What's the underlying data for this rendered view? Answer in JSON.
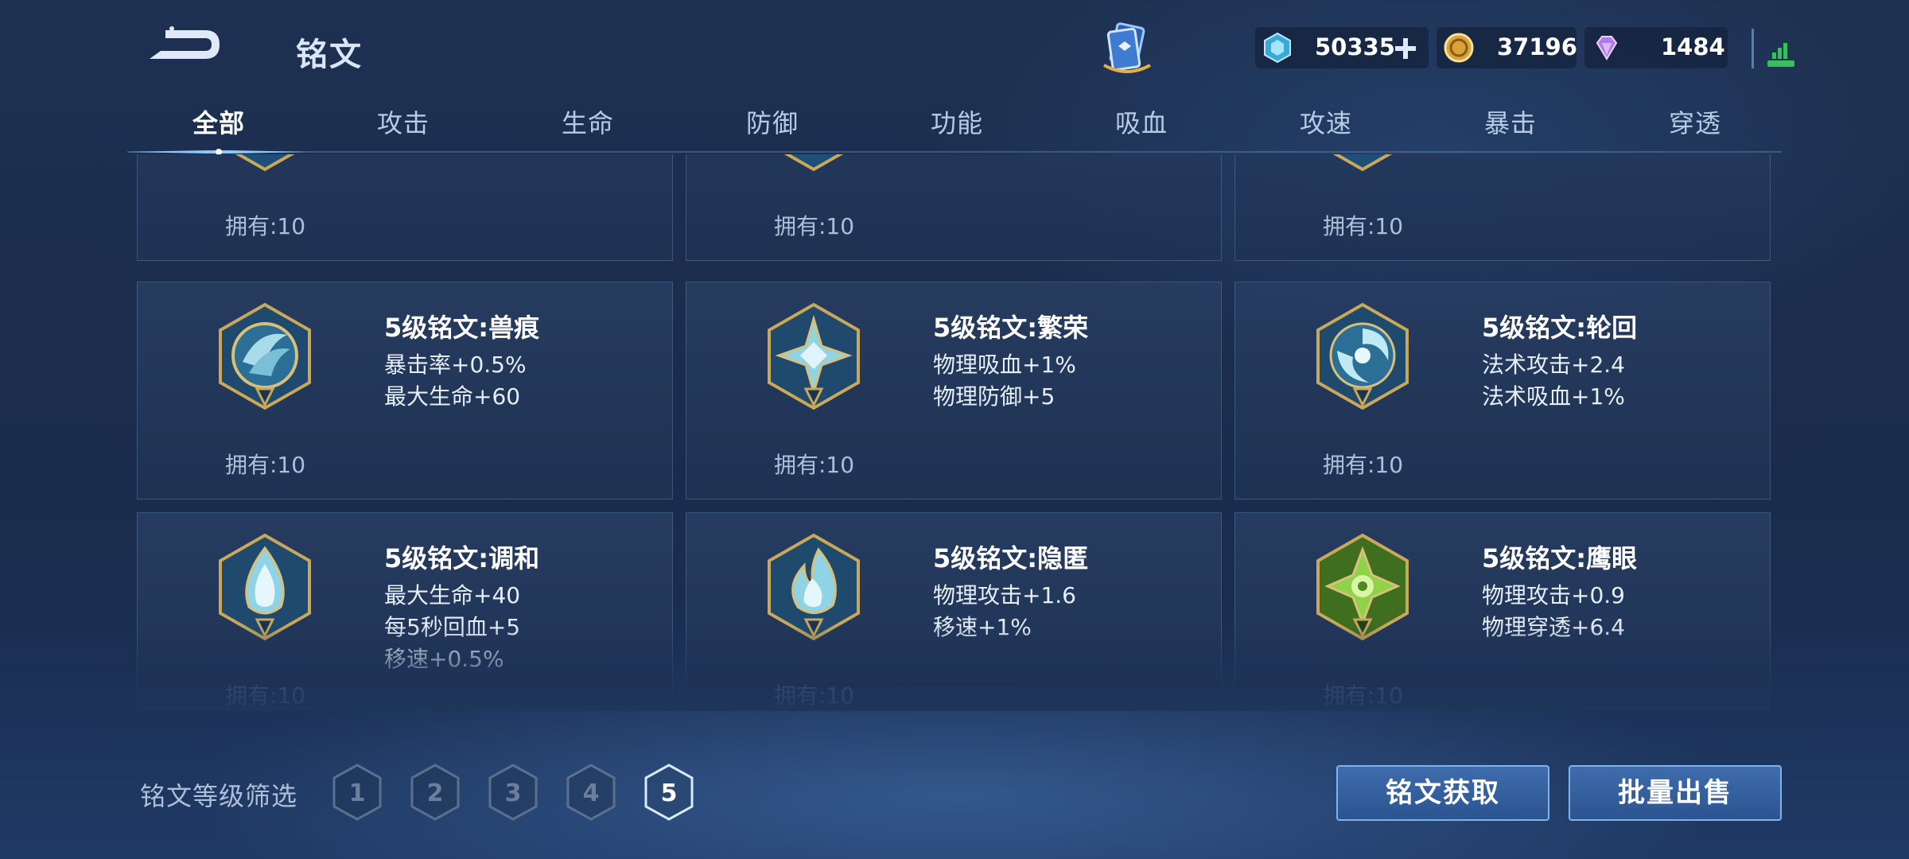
{
  "header": {
    "title": "铭文",
    "currencies": {
      "coupon": "50335",
      "gold": "37196",
      "gem": "1484"
    }
  },
  "tabs": [
    {
      "label": "全部",
      "active": true
    },
    {
      "label": "攻击"
    },
    {
      "label": "生命"
    },
    {
      "label": "防御"
    },
    {
      "label": "功能"
    },
    {
      "label": "吸血"
    },
    {
      "label": "攻速"
    },
    {
      "label": "暴击"
    },
    {
      "label": "穿透"
    }
  ],
  "cards": [
    {
      "name": "",
      "attrs": [],
      "owned": "拥有:10"
    },
    {
      "name": "",
      "attrs": [],
      "owned": "拥有:10"
    },
    {
      "name": "",
      "attrs": [],
      "owned": "拥有:10"
    },
    {
      "name": "5级铭文:兽痕",
      "attrs": [
        "暴击率+0.5%",
        "最大生命+60"
      ],
      "owned": "拥有:10"
    },
    {
      "name": "5级铭文:繁荣",
      "attrs": [
        "物理吸血+1%",
        "物理防御+5"
      ],
      "owned": "拥有:10"
    },
    {
      "name": "5级铭文:轮回",
      "attrs": [
        "法术攻击+2.4",
        "法术吸血+1%"
      ],
      "owned": "拥有:10"
    },
    {
      "name": "5级铭文:调和",
      "attrs": [
        "最大生命+40",
        "每5秒回血+5",
        "移速+0.5%"
      ],
      "owned": "拥有:10"
    },
    {
      "name": "5级铭文:隐匿",
      "attrs": [
        "物理攻击+1.6",
        "移速+1%"
      ],
      "owned": "拥有:10"
    },
    {
      "name": "5级铭文:鹰眼",
      "attrs": [
        "物理攻击+0.9",
        "物理穿透+6.4"
      ],
      "owned": "拥有:10"
    }
  ],
  "filter": {
    "label": "铭文等级筛选",
    "levels": [
      "1",
      "2",
      "3",
      "4",
      "5"
    ],
    "selected": "5"
  },
  "buttons": {
    "get": "铭文获取",
    "sell": "批量出售"
  },
  "colors": {
    "accent": "#7fb2ef",
    "gold_frame": "#c9a85a"
  }
}
